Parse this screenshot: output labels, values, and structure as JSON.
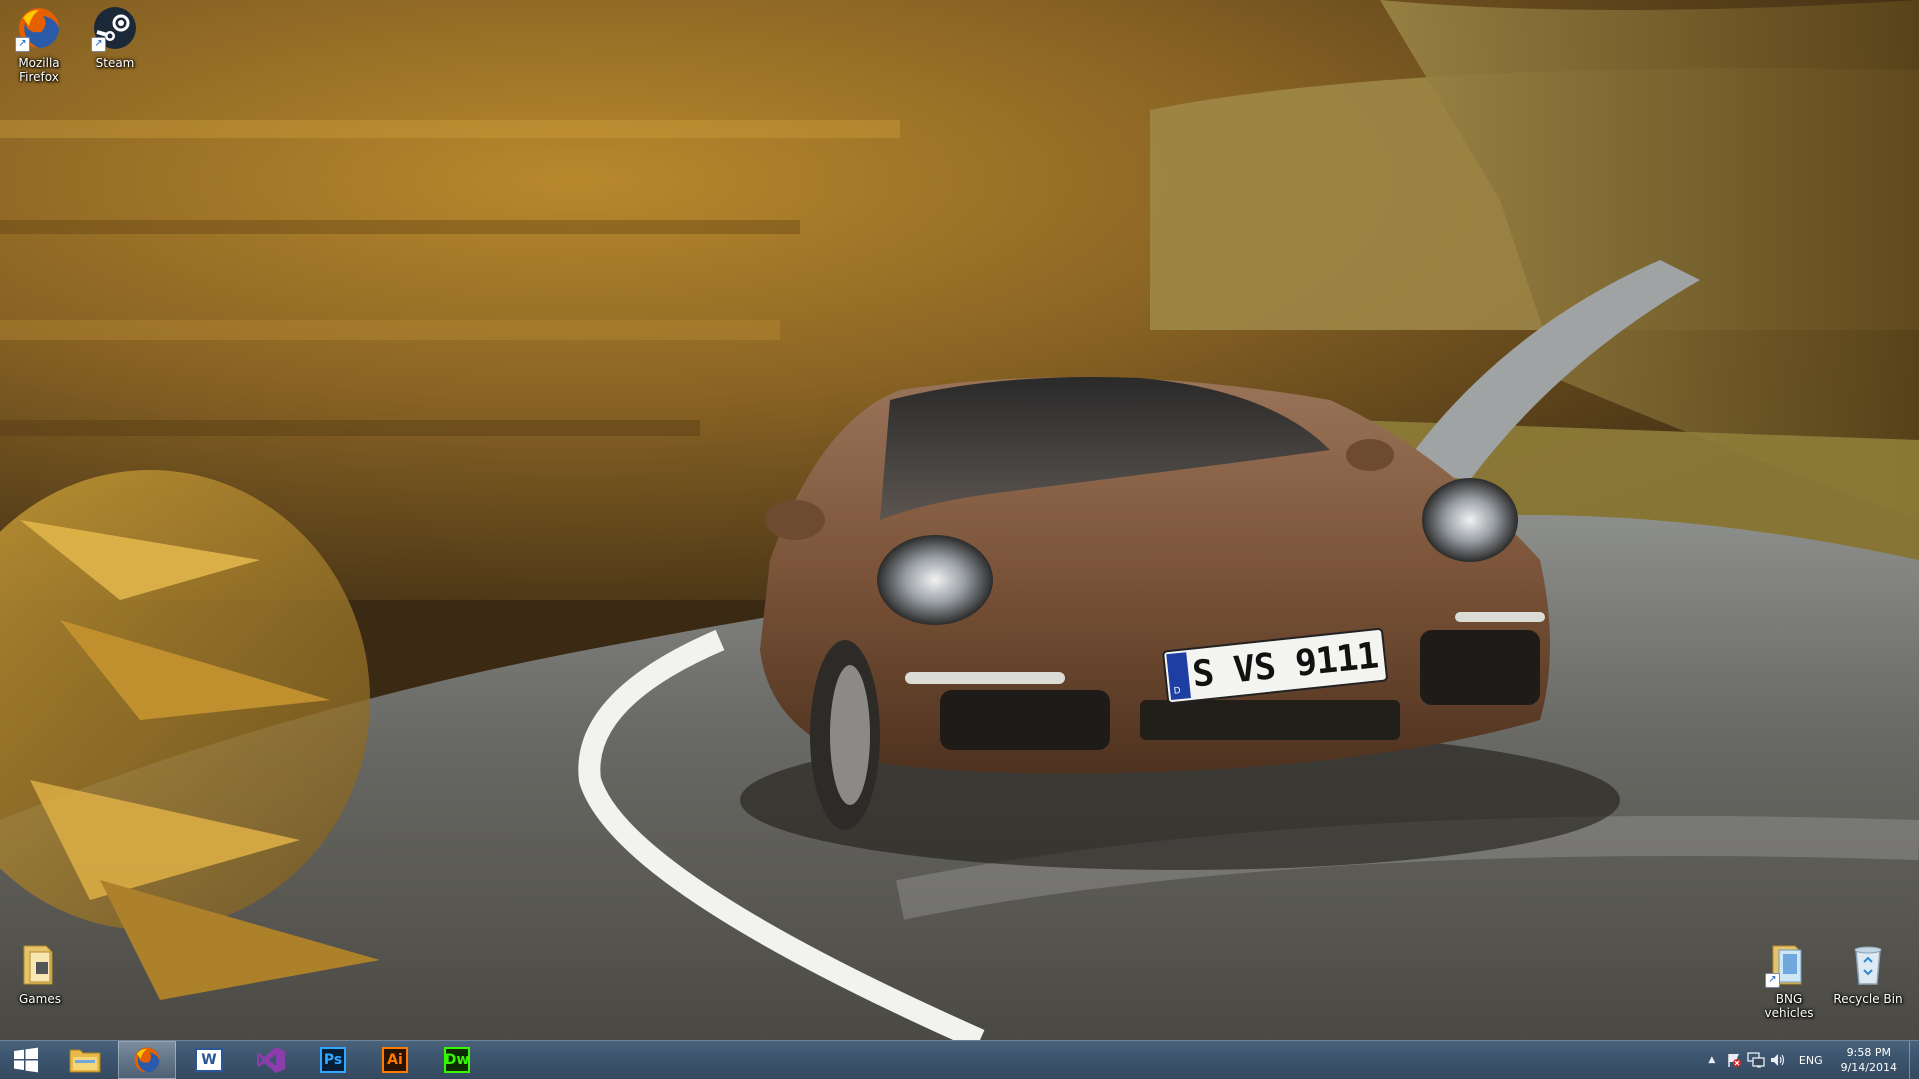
{
  "desktop": {
    "icons_left_top": [
      {
        "label": "Mozilla Firefox",
        "icon": "firefox-icon"
      },
      {
        "label": "Steam",
        "icon": "steam-icon"
      }
    ],
    "icon_games": {
      "label": "Games",
      "icon": "folder-icon"
    },
    "icon_bng": {
      "label": "BNG vehicles",
      "icon": "folder-icon"
    },
    "icon_recycle": {
      "label": "Recycle Bin",
      "icon": "recycle-bin-icon"
    }
  },
  "wallpaper": {
    "license_plate": "S VS 9111",
    "plate_country": "D"
  },
  "taskbar": {
    "start": {
      "icon": "windows-start-icon"
    },
    "pinned": [
      {
        "name": "File Explorer",
        "icon": "folder-icon"
      },
      {
        "name": "Firefox",
        "icon": "firefox-icon",
        "active": true
      },
      {
        "name": "Word",
        "label": "W",
        "icon": "word-icon",
        "color": "#2b5797"
      },
      {
        "name": "Visual Studio",
        "icon": "visual-studio-icon",
        "color": "#68217a"
      },
      {
        "name": "Photoshop",
        "label": "Ps",
        "icon": "photoshop-icon",
        "color": "#31a8ff"
      },
      {
        "name": "Illustrator",
        "label": "Ai",
        "icon": "illustrator-icon",
        "color": "#ff7c00"
      },
      {
        "name": "Dreamweaver",
        "label": "Dw",
        "icon": "dreamweaver-icon",
        "color": "#35fa00"
      }
    ],
    "tray": {
      "language": "ENG",
      "time": "9:58 PM",
      "date": "9/14/2014"
    }
  }
}
